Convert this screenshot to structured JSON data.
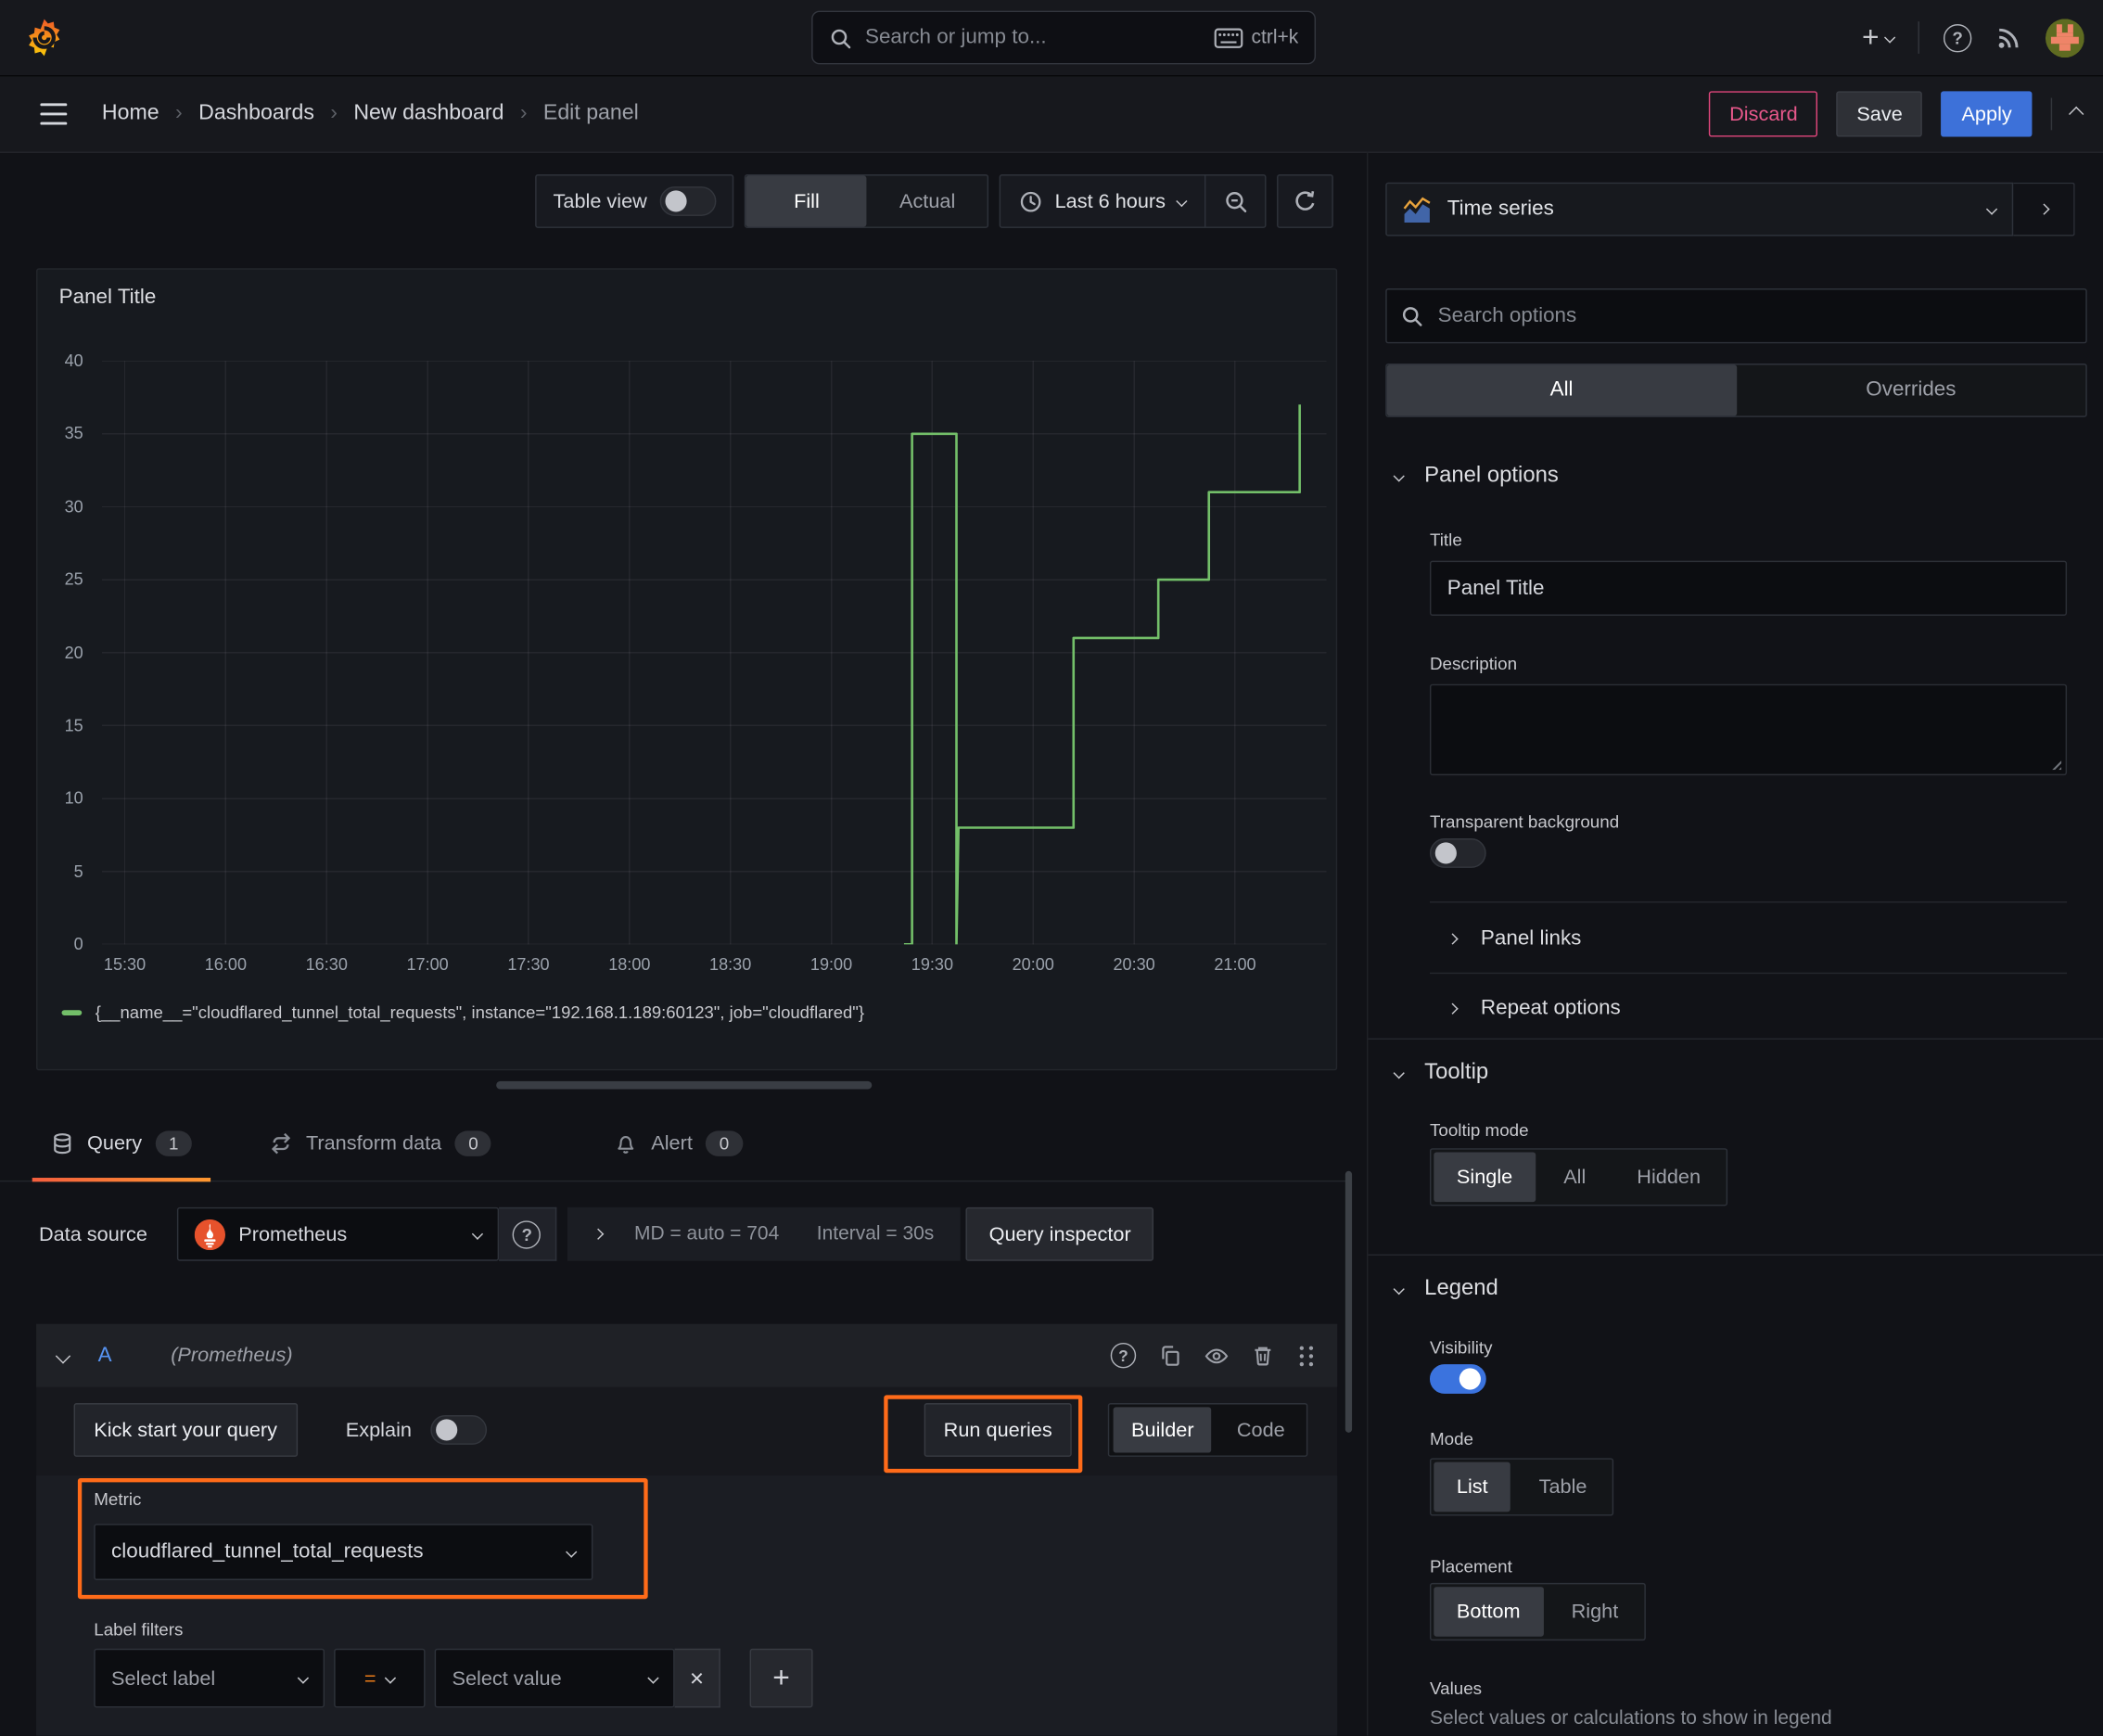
{
  "topbar": {
    "search_placeholder": "Search or jump to...",
    "shortcut": "ctrl+k"
  },
  "nav": {
    "breadcrumb": [
      "Home",
      "Dashboards",
      "New dashboard",
      "Edit panel"
    ],
    "discard": "Discard",
    "save": "Save",
    "apply": "Apply"
  },
  "toolbar": {
    "table_view": "Table view",
    "fill": "Fill",
    "actual": "Actual",
    "time_range": "Last 6 hours"
  },
  "panel": {
    "title": "Panel Title",
    "legend_label": "{__name__=\"cloudflared_tunnel_total_requests\", instance=\"192.168.1.189:60123\", job=\"cloudflared\"}"
  },
  "chart_data": {
    "type": "line",
    "title": "Panel Title",
    "x_ticks": [
      "15:30",
      "16:00",
      "16:30",
      "17:00",
      "17:30",
      "18:00",
      "18:30",
      "19:00",
      "19:30",
      "20:00",
      "20:30",
      "21:00"
    ],
    "x_tick_hours": [
      15.5,
      16,
      16.5,
      17,
      17.5,
      18,
      18.5,
      19,
      19.5,
      20,
      20.5,
      21
    ],
    "y_ticks": [
      0,
      5,
      10,
      15,
      20,
      25,
      30,
      35,
      40
    ],
    "x_range": [
      15.387,
      21.453
    ],
    "y_range": [
      0,
      40
    ],
    "grid": true,
    "legend_position": "bottom",
    "series": [
      {
        "name": "{__name__=\"cloudflared_tunnel_total_requests\", instance=\"192.168.1.189:60123\", job=\"cloudflared\"}",
        "color": "#73bf69",
        "points": [
          [
            19.36,
            0
          ],
          [
            19.4,
            0
          ],
          [
            19.4,
            35
          ],
          [
            19.62,
            35
          ],
          [
            19.62,
            0
          ],
          [
            19.63,
            8
          ],
          [
            20.2,
            8
          ],
          [
            20.2,
            21
          ],
          [
            20.62,
            21
          ],
          [
            20.62,
            25
          ],
          [
            20.87,
            25
          ],
          [
            20.87,
            31
          ],
          [
            21.32,
            31
          ],
          [
            21.32,
            37
          ]
        ]
      }
    ]
  },
  "tabs": {
    "query": "Query",
    "query_count": "1",
    "transform": "Transform data",
    "transform_count": "0",
    "alert": "Alert",
    "alert_count": "0"
  },
  "datasource": {
    "label": "Data source",
    "name": "Prometheus",
    "stats_md": "MD = auto = 704",
    "stats_interval": "Interval = 30s",
    "query_inspector": "Query inspector"
  },
  "query_row": {
    "ref_id": "A",
    "datasource_hint": "(Prometheus)"
  },
  "query_editor": {
    "kick_start": "Kick start your query",
    "explain": "Explain",
    "run_queries": "Run queries",
    "builder": "Builder",
    "code": "Code",
    "metric_label": "Metric",
    "metric_value": "cloudflared_tunnel_total_requests",
    "label_filters": "Label filters",
    "select_label": "Select label",
    "operator": "=",
    "select_value": "Select value"
  },
  "sidebar": {
    "visualization": "Time series",
    "search_placeholder": "Search options",
    "tab_all": "All",
    "tab_overrides": "Overrides",
    "panel_options": {
      "title": "Panel options",
      "title_label": "Title",
      "title_value": "Panel Title",
      "description_label": "Description",
      "transparent_label": "Transparent background"
    },
    "collapsed": {
      "panel_links": "Panel links",
      "repeat_options": "Repeat options"
    },
    "tooltip": {
      "title": "Tooltip",
      "mode_label": "Tooltip mode",
      "options": [
        "Single",
        "All",
        "Hidden"
      ]
    },
    "legend": {
      "title": "Legend",
      "visibility_label": "Visibility",
      "mode_label": "Mode",
      "mode_options": [
        "List",
        "Table"
      ],
      "placement_label": "Placement",
      "placement_options": [
        "Bottom",
        "Right"
      ],
      "values_label": "Values",
      "values_hint": "Select values or calculations to show in legend"
    }
  },
  "colors": {
    "annotation_orange": "#ff6b19",
    "line_green": "#73bf69",
    "apply_blue": "#3d71d9",
    "discard_pink": "#e0467c",
    "toggle_blue": "#3b73de",
    "tab_underline": "#ff780a",
    "prometheus_orange": "#e6522c"
  }
}
